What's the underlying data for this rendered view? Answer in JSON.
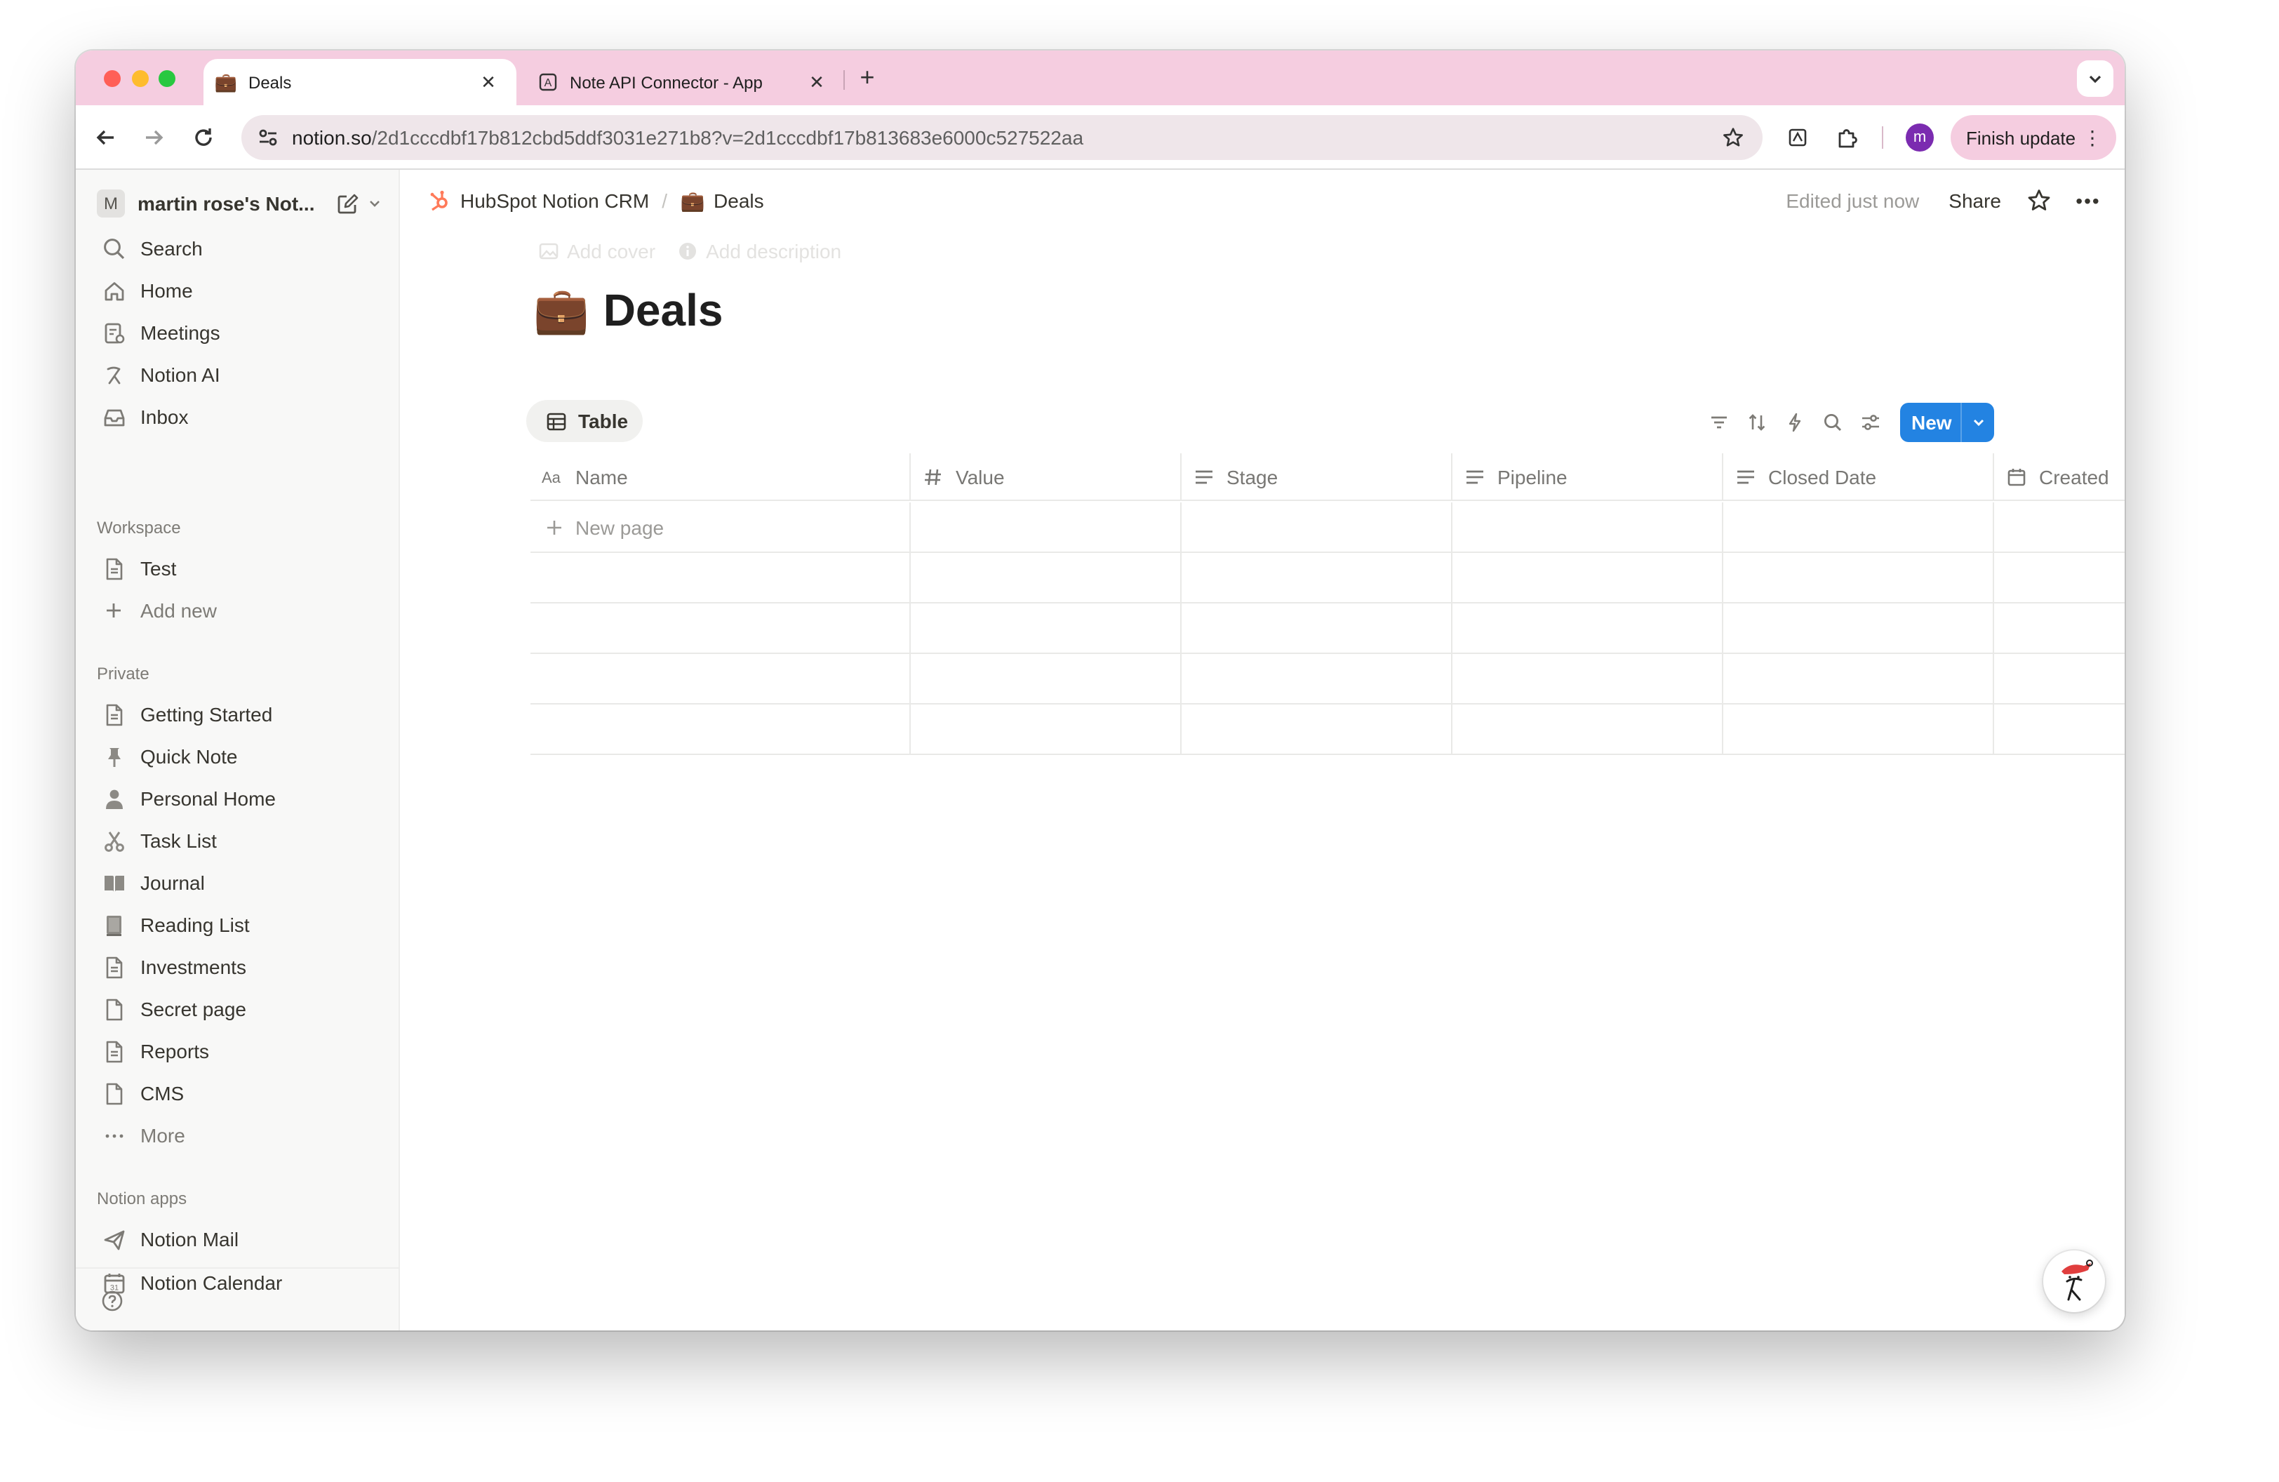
{
  "browser": {
    "tabs": [
      {
        "title": "Deals",
        "favicon": "briefcase-icon",
        "active": true
      },
      {
        "title": "Note API Connector - App",
        "favicon": "app-icon",
        "active": false
      }
    ],
    "url_host": "notion.so",
    "url_path": "/2d1cccdbf17b812cbd5ddf3031e271b8?v=2d1cccdbf17b813683e6000c527522aa",
    "profile_initial": "m",
    "finish_update_label": "Finish update",
    "colors": {
      "tab_strip": "#f5cde0",
      "profile": "#7b2bb0"
    }
  },
  "sidebar": {
    "workspace_initial": "M",
    "workspace_name": "martin rose's Not...",
    "top_items": [
      {
        "label": "Search",
        "icon": "search-icon"
      },
      {
        "label": "Home",
        "icon": "home-icon"
      },
      {
        "label": "Meetings",
        "icon": "meetings-icon"
      },
      {
        "label": "Notion AI",
        "icon": "notion-ai-icon"
      },
      {
        "label": "Inbox",
        "icon": "inbox-icon"
      }
    ],
    "workspace_heading": "Workspace",
    "workspace_items": [
      {
        "label": "Test",
        "icon": "page-icon"
      },
      {
        "label": "Add new",
        "icon": "plus-icon"
      }
    ],
    "private_heading": "Private",
    "private_items": [
      {
        "label": "Getting Started",
        "icon": "page-icon"
      },
      {
        "label": "Quick Note",
        "icon": "pin-icon"
      },
      {
        "label": "Personal Home",
        "icon": "person-icon"
      },
      {
        "label": "Task List",
        "icon": "scissors-icon"
      },
      {
        "label": "Journal",
        "icon": "book-icon"
      },
      {
        "label": "Reading List",
        "icon": "books-icon"
      },
      {
        "label": "Investments",
        "icon": "page-icon"
      },
      {
        "label": "Secret page",
        "icon": "page-icon"
      },
      {
        "label": "Reports",
        "icon": "page-icon"
      },
      {
        "label": "CMS",
        "icon": "page-icon"
      },
      {
        "label": "More",
        "icon": "ellipsis-icon"
      }
    ],
    "apps_heading": "Notion apps",
    "app_items": [
      {
        "label": "Notion Mail",
        "icon": "mail-icon"
      },
      {
        "label": "Notion Calendar",
        "icon": "calendar-icon"
      }
    ]
  },
  "main": {
    "breadcrumb": [
      {
        "label": "HubSpot Notion CRM",
        "icon": "hubspot-icon"
      },
      {
        "label": "Deals",
        "icon": "briefcase-icon"
      }
    ],
    "edited_text": "Edited just now",
    "share_label": "Share",
    "add_cover": "Add cover",
    "add_description": "Add description",
    "title_emoji": "💼",
    "title": "Deals",
    "view_tab": "Table",
    "new_button": "New",
    "accent": "#2383e2",
    "columns": [
      {
        "label": "Name",
        "icon": "text-icon"
      },
      {
        "label": "Value",
        "icon": "number-icon"
      },
      {
        "label": "Stage",
        "icon": "select-icon"
      },
      {
        "label": "Pipeline",
        "icon": "select-icon"
      },
      {
        "label": "Closed Date",
        "icon": "select-icon"
      },
      {
        "label": "Created",
        "icon": "calendar-icon"
      }
    ],
    "new_page_label": "New page"
  }
}
